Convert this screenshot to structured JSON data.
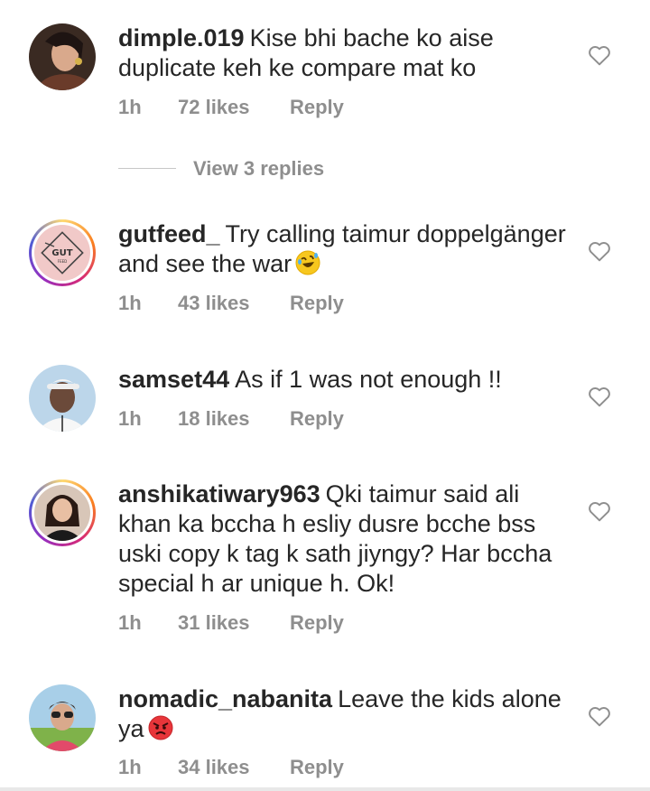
{
  "view_replies": "View 3 replies",
  "comments": [
    {
      "username": "dimple.019",
      "text": "Kise bhi bache ko aise duplicate keh ke compare mat ko",
      "time": "1h",
      "likes": "72 likes",
      "reply": "Reply",
      "emoji": null
    },
    {
      "username": "gutfeed_",
      "text": "Try calling taimur doppelgänger and see the war",
      "time": "1h",
      "likes": "43 likes",
      "reply": "Reply",
      "emoji": "rolling-laughing-emoji",
      "avatar_logo_text": "GUT",
      "avatar_logo_subtext": "FEED"
    },
    {
      "username": "samset44",
      "text": "As if 1 was not enough !!",
      "time": "1h",
      "likes": "18 likes",
      "reply": "Reply",
      "emoji": null
    },
    {
      "username": "anshikatiwary963",
      "text": "Qki taimur said ali khan ka bccha h esliy dusre bcche bss uski copy k tag k sath jiyngy? Har bccha special h ar unique h. Ok!",
      "time": "1h",
      "likes": "31 likes",
      "reply": "Reply",
      "emoji": null
    },
    {
      "username": "nomadic_nabanita",
      "text": "Leave the kids alone ya",
      "time": "1h",
      "likes": "34 likes",
      "reply": "Reply",
      "emoji": "angry-face-emoji"
    }
  ],
  "colors": {
    "text": "#262626",
    "meta": "#8e8e8e",
    "ring_start": "#feda75",
    "ring_end": "#962fbf"
  }
}
